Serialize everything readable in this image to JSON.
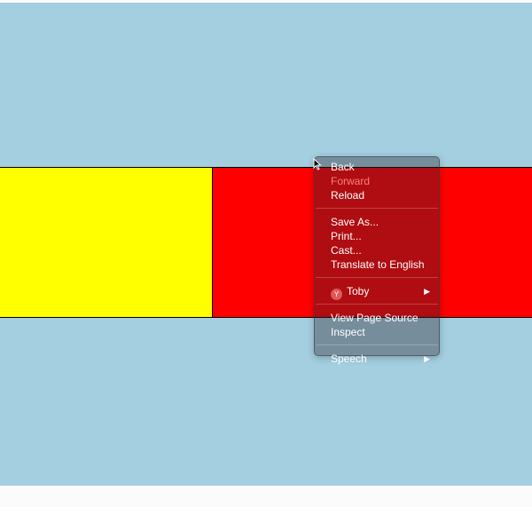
{
  "page": {
    "colors": {
      "background": "#a4cfe0",
      "left_box": "#ffff00",
      "right_box": "#ff0000"
    }
  },
  "context_menu": {
    "items": [
      {
        "label": "Back",
        "enabled": true
      },
      {
        "label": "Forward",
        "enabled": false
      },
      {
        "label": "Reload",
        "enabled": true
      },
      {
        "label": "Save As...",
        "enabled": true
      },
      {
        "label": "Print...",
        "enabled": true
      },
      {
        "label": "Cast...",
        "enabled": true
      },
      {
        "label": "Translate to English",
        "enabled": true
      },
      {
        "label": "Toby",
        "enabled": true,
        "icon": "toby-extension-icon",
        "submenu": true
      },
      {
        "label": "View Page Source",
        "enabled": true
      },
      {
        "label": "Inspect",
        "enabled": true
      },
      {
        "label": "Speech",
        "enabled": true,
        "submenu": true
      }
    ],
    "submenu_arrow": "▶"
  }
}
